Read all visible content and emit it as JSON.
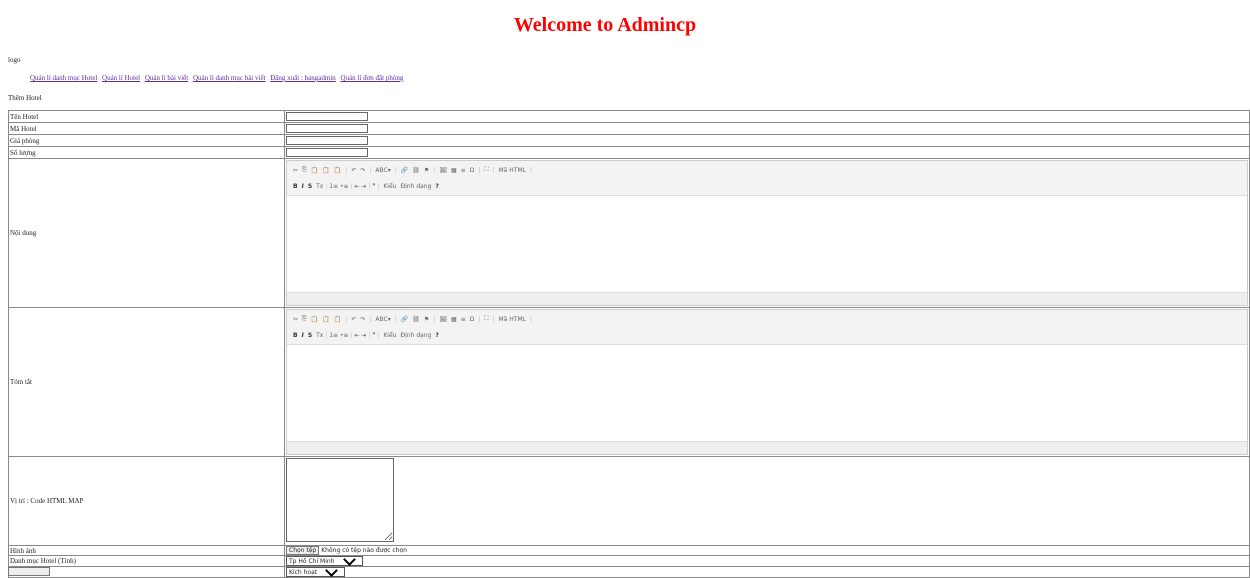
{
  "page": {
    "title": "Welcome to Admincp",
    "logo_text": "logo",
    "heading": "Thêm Hotel"
  },
  "nav": [
    "Quản lí danh mục Hotel",
    "Quản lí Hotel",
    "Quản lí bài viết",
    "Quản lí danh mục bài viết",
    "Đăng xuất : bangadmin",
    "Quản lí đơn đặt phòng"
  ],
  "form": {
    "ten_hotel_label": "Tên Hotel",
    "ma_hotel_label": "Mã Hotel",
    "gia_phong_label": "Giá phòng",
    "so_luong_label": "Số lượng",
    "noi_dung_label": "Nội dung",
    "tom_tat_label": "Tóm tắt",
    "vi_tri_label": "Vị trí : Code HTML MAP",
    "hinh_anh_label": "Hình ảnh",
    "danh_muc_label": "Danh mục Hotel (Tỉnh)",
    "tinh_trang_label": "Tình trạng",
    "file_button": "Chọn tệp",
    "file_status": "Không có tệp nào được chọn",
    "danh_muc_value": "Tp Hồ Chí Minh",
    "tinh_trang_value": "Kích hoạt"
  },
  "editor": {
    "row1": [
      "✂",
      "⎘",
      "📋",
      "📋",
      "📋",
      "|",
      "↶",
      "↷",
      "|",
      "ABC▾",
      "|",
      "🔗",
      "⛓",
      "⚑",
      "|",
      "🖼",
      "▦",
      "≡",
      "Ω",
      "|",
      "⛶",
      "|",
      "Mã HTML",
      "|"
    ],
    "row2_bold": "B",
    "row2_italic": "I",
    "row2_strike": "S",
    "row2": [
      "Tx",
      "|",
      "1≡",
      "•≡",
      "|",
      "⇤",
      "⇥",
      "|",
      "❞",
      "|"
    ],
    "style_label": "Kiểu",
    "format_label": "Định dạng",
    "help": "?"
  }
}
